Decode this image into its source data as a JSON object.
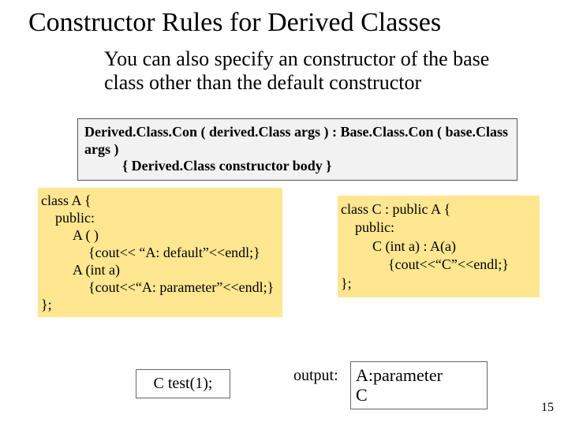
{
  "title": "Constructor Rules for Derived Classes",
  "subtitle": "You can also specify an constructor of the base class other than the default constructor",
  "syntax": {
    "line1": "Derived.Class.Con ( derived.Class args ) : Base.Class.Con ( base.Class args )",
    "line2": "{  Derived.Class constructor body  }"
  },
  "classA": {
    "l1": "class A {",
    "l2": "public:",
    "l3": "A ( )",
    "l4": "{cout<< “A: default”<<endl;}",
    "l5": "A (int a)",
    "l6": "{cout<<“A: parameter”<<endl;}",
    "l7": "};"
  },
  "classC": {
    "l1": "class C : public A {",
    "l2": "public:",
    "l3": "C (int a) : A(a)",
    "l4": "{cout<<“C”<<endl;}",
    "l5": "};"
  },
  "call": "C test(1);",
  "output_label": "output:",
  "output": {
    "l1": "A:parameter",
    "l2": "C"
  },
  "page": "15"
}
